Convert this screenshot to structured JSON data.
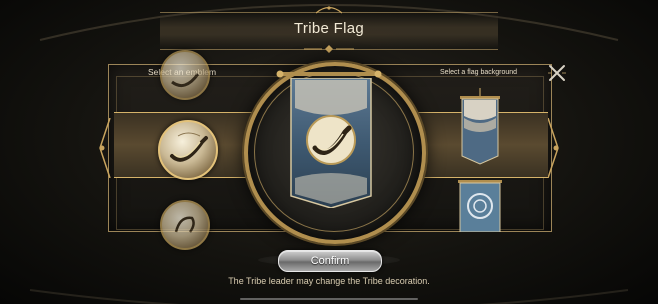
{
  "header": {
    "title": "Tribe Flag"
  },
  "emblem_section": {
    "label": "Select an emblem",
    "selected_index": 1
  },
  "background_section": {
    "label": "Select a flag background",
    "selected_index": 0
  },
  "buttons": {
    "confirm_label": "Confirm",
    "close_icon": "close-icon"
  },
  "footer": {
    "notice": "The Tribe leader may change the Tribe decoration."
  },
  "colors": {
    "gold": "#d6b36a",
    "panel_border": "#9c8558",
    "text": "#e8dcc0"
  }
}
